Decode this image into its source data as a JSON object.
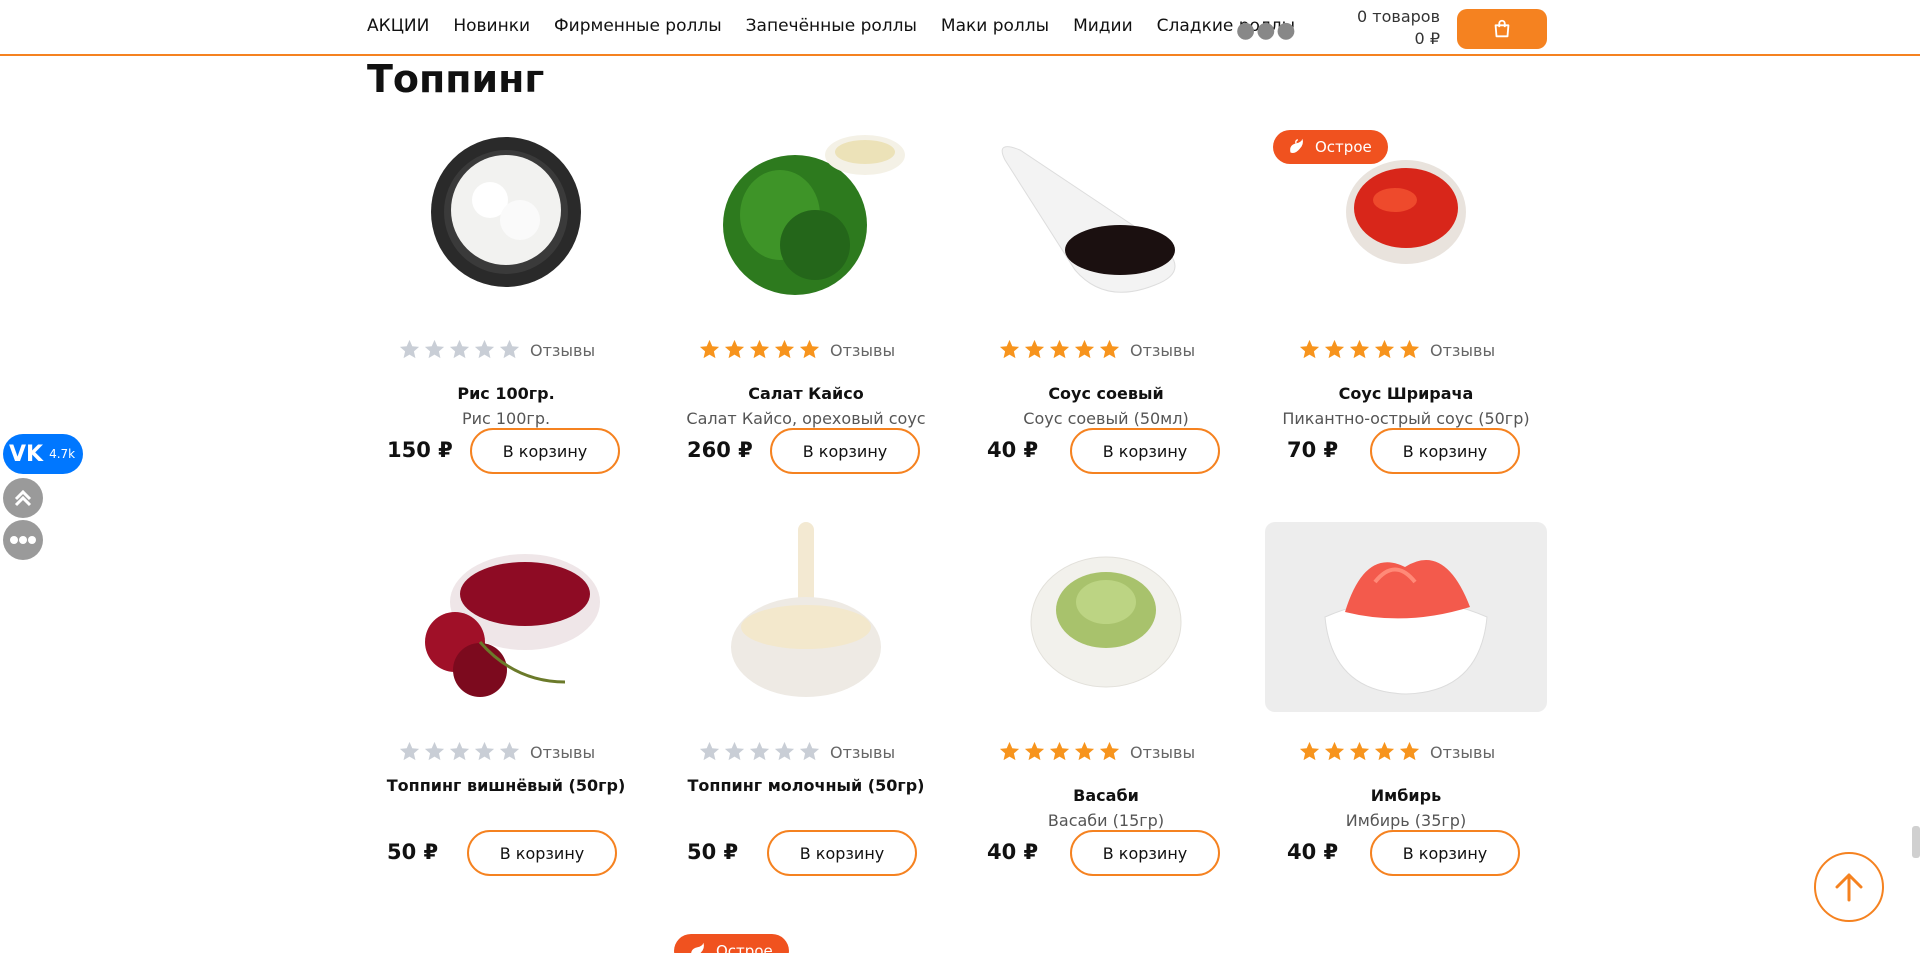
{
  "header": {
    "nav": [
      "АКЦИИ",
      "Новинки",
      "Фирменные роллы",
      "Запечённые роллы",
      "Маки роллы",
      "Мидии",
      "Сладкие роллы"
    ],
    "more_icon": "more-dots-icon",
    "cart_count": "0 товаров",
    "cart_sum": "0 ₽",
    "cart_icon": "shopping-bag-icon"
  },
  "page": {
    "title": "Топпинг"
  },
  "colors": {
    "accent": "#f58220",
    "badge": "#f0521f",
    "star_active": "#f7941d",
    "star_inactive": "#c9ced6",
    "vk": "#0077ff"
  },
  "products": [
    {
      "name": "Рис 100гр.",
      "desc": "Рис 100гр.",
      "price": "150 ₽",
      "button": "В корзину",
      "reviews": "Отзывы",
      "stars_active": false,
      "badge": "",
      "image": "rice-bowl"
    },
    {
      "name": "Салат Кайсо",
      "desc": "Салат Кайсо, ореховый соус",
      "price": "260 ₽",
      "button": "В корзину",
      "reviews": "Отзывы",
      "stars_active": true,
      "badge": "",
      "image": "seaweed-salad"
    },
    {
      "name": "Соус соевый",
      "desc": "Соус соевый (50мл)",
      "price": "40 ₽",
      "button": "В корзину",
      "reviews": "Отзывы",
      "stars_active": true,
      "badge": "",
      "image": "soy-sauce"
    },
    {
      "name": "Соус Шрирача",
      "desc": "Пикантно-острый соус (50гр)",
      "price": "70 ₽",
      "button": "В корзину",
      "reviews": "Отзывы",
      "stars_active": true,
      "badge": "Острое",
      "image": "sriracha"
    },
    {
      "name": "Топпинг вишнёвый (50гр)",
      "desc": "",
      "price": "50 ₽",
      "button": "В корзину",
      "reviews": "Отзывы",
      "stars_active": false,
      "badge": "",
      "image": "cherry-topping"
    },
    {
      "name": "Топпинг молочный (50гр)",
      "desc": "",
      "price": "50 ₽",
      "button": "В корзину",
      "reviews": "Отзывы",
      "stars_active": false,
      "badge": "",
      "image": "milk-topping"
    },
    {
      "name": "Васаби",
      "desc": "Васаби (15гр)",
      "price": "40 ₽",
      "button": "В корзину",
      "reviews": "Отзывы",
      "stars_active": true,
      "badge": "",
      "image": "wasabi"
    },
    {
      "name": "Имбирь",
      "desc": "Имбирь (35гр)",
      "price": "40 ₽",
      "button": "В корзину",
      "reviews": "Отзывы",
      "stars_active": true,
      "badge": "",
      "image": "ginger"
    }
  ],
  "peek_badge": "Острое",
  "sidebar": {
    "vk_count": "4.7k"
  }
}
